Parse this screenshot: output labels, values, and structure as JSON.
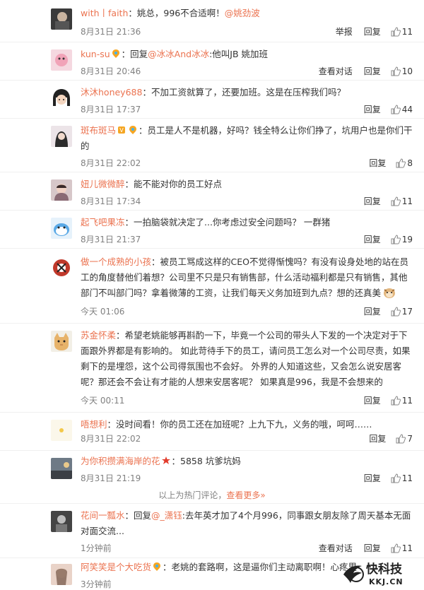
{
  "comments": [
    {
      "user": "with丨faith",
      "text": "：姚总，996不合适啊！",
      "mention": "@姚劲波",
      "time": "8月31日 21:36",
      "actions": [
        "举报",
        "回复"
      ],
      "likes": "11"
    },
    {
      "user": "kun-su",
      "text_pre": "：回复",
      "mention": "@冰冰And冰冰",
      "text": ":他叫JB 姚加班",
      "time": "8月31日 20:46",
      "actions": [
        "查看对话",
        "回复"
      ],
      "likes": "10"
    },
    {
      "user": "沐沐honey688",
      "text": "：不加工资就算了，还要加班。这是在压榨我们吗？",
      "time": "8月31日 17:37",
      "actions": [
        "回复"
      ],
      "likes": "44"
    },
    {
      "user": "斑布斑马",
      "text": "：员工是人不是机器，好吗？钱全特么让你们挣了，坑用户也是你们干的",
      "time": "8月31日 22:02",
      "actions": [
        "回复"
      ],
      "likes": "8"
    },
    {
      "user": "妞儿微微醉",
      "text": "：能不能对你的员工好点",
      "time": "8月31日 17:34",
      "actions": [
        "回复"
      ],
      "likes": "11"
    },
    {
      "user": "起飞吧果冻",
      "text": "：一拍脑袋就决定了...你考虑过安全问题吗？ 一群猪",
      "time": "8月31日 21:37",
      "actions": [
        "回复"
      ],
      "likes": "19"
    },
    {
      "user": "做一个成熟的小孩",
      "text": "：被员工骂成这样的CEO不觉得惭愧吗？有没有设身处地的站在员工的角度替他们着想？公司里不只是只有销售部，什么活动福利都是只有销售，其他部门不叫部门吗？拿着微薄的工资，让我们每天义务加班到九点？想的还真美",
      "time": "今天 01:06",
      "actions": [
        "回复"
      ],
      "likes": "17"
    },
    {
      "user": "苏金怀柔",
      "text": "：希望老姚能够再斟酌一下，毕竟一个公司的带头人下发的一个决定对于下面跟外界都是有影响的。 如此苛待手下的员工，请问员工怎么对一个公司尽责，如果剩下的是埋怨，这个公司得氛围也不会好。 外界的人知道这些，又会怎么说安居客呢？那还会不会让有才能的人想来安居客呢？ 如果真是996，我是不会想来的",
      "time": "今天 00:11",
      "actions": [
        "回复"
      ],
      "likes": "11"
    },
    {
      "user": "唔想利",
      "text": "：没时间看！你的员工还在加班呢？上九下九，义务的哦，呵呵……",
      "time": "8月31日 22:02",
      "actions": [
        "回复"
      ],
      "likes": "7"
    },
    {
      "user": "为你积攒满海岸的花",
      "text": "：5858 坑爹坑妈",
      "time": "8月31日 21:19",
      "actions": [
        "回复"
      ],
      "likes": "11"
    },
    {
      "user": "花间一瓢水",
      "text_pre": "：回复",
      "mention": "@_潇钰",
      "text": ":去年英才加了4个月996，同事跟女朋友除了周天基本无面对面交流...",
      "time": "1分钟前",
      "actions": [
        "查看对话",
        "回复"
      ],
      "likes": "11"
    },
    {
      "user": "阿笑笑是个大吃货",
      "text": "：老姚的套路啊，这是逼你们主动离职啊！心疼里",
      "time": "3分钟前",
      "actions": [],
      "likes": ""
    }
  ],
  "more_bar": {
    "text": "以上为热门评论，",
    "link": "查看更多»"
  },
  "watermark": {
    "name": "快科技",
    "url": "KKJ.CN"
  },
  "colors": {
    "accent": "#eb7350",
    "muted": "#808080"
  }
}
